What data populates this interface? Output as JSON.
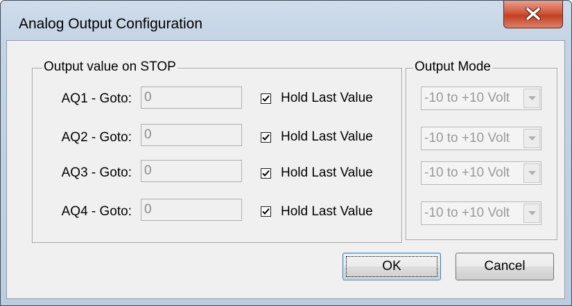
{
  "window": {
    "title": "Analog Output Configuration"
  },
  "groups": {
    "stop_title": "Output value on STOP",
    "mode_title": "Output Mode"
  },
  "rows": [
    {
      "label": "AQ1 - Goto:",
      "value": "0",
      "hold_label": "Hold Last Value",
      "hold_checked": true,
      "mode": "-10 to +10 Volt"
    },
    {
      "label": "AQ2 - Goto:",
      "value": "0",
      "hold_label": "Hold Last Value",
      "hold_checked": true,
      "mode": "-10 to +10 Volt"
    },
    {
      "label": "AQ3 - Goto:",
      "value": "0",
      "hold_label": "Hold Last Value",
      "hold_checked": true,
      "mode": "-10 to +10 Volt"
    },
    {
      "label": "AQ4 - Goto:",
      "value": "0",
      "hold_label": "Hold Last Value",
      "hold_checked": true,
      "mode": "-10 to +10 Volt"
    }
  ],
  "buttons": {
    "ok_label": "OK",
    "cancel_label": "Cancel"
  },
  "icons": {
    "close": "close-x-icon",
    "checkmark": "checkmark-icon",
    "dropdown": "chevron-down-icon"
  },
  "colors": {
    "close_button": "#c94a2e",
    "dialog_face": "#f0f0f0",
    "frame": "#c4d4e6"
  }
}
